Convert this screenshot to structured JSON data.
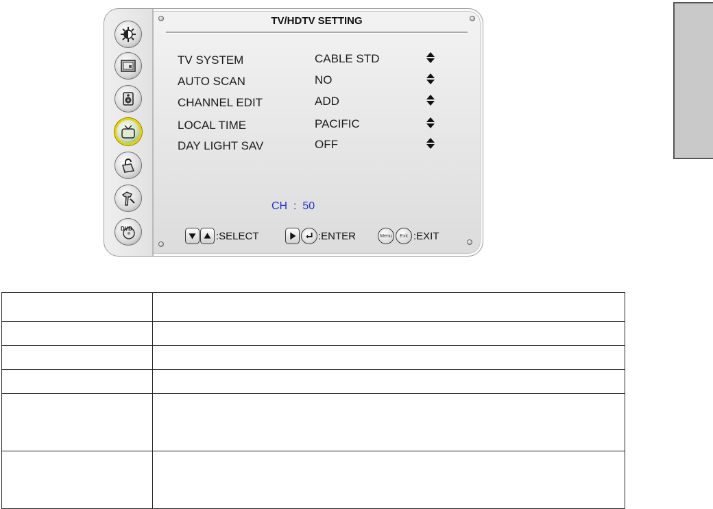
{
  "osd": {
    "title": "TV/HDTV SETTING",
    "rail_icons": [
      "picture-icon",
      "screen-icon",
      "audio-icon",
      "tv-icon",
      "lock-icon",
      "setup-icon",
      "dvd-icon"
    ],
    "active_icon": "tv-icon",
    "rows": [
      {
        "label": "TV SYSTEM",
        "value": "CABLE STD"
      },
      {
        "label": "AUTO SCAN",
        "value": "NO"
      },
      {
        "label": "CHANNEL EDIT",
        "value": "ADD"
      },
      {
        "label": "LOCAL TIME",
        "value": "PACIFIC"
      },
      {
        "label": "DAY LIGHT SAV",
        "value": "OFF"
      }
    ],
    "channel": "CH  :  50",
    "channel_color": "#2233cc",
    "footer": {
      "select_label": ":SELECT",
      "enter_label": ":ENTER",
      "exit_label": ":EXIT",
      "menu_key": "Menu",
      "exit_key": "Exit"
    }
  },
  "table": {
    "rows": 6
  }
}
